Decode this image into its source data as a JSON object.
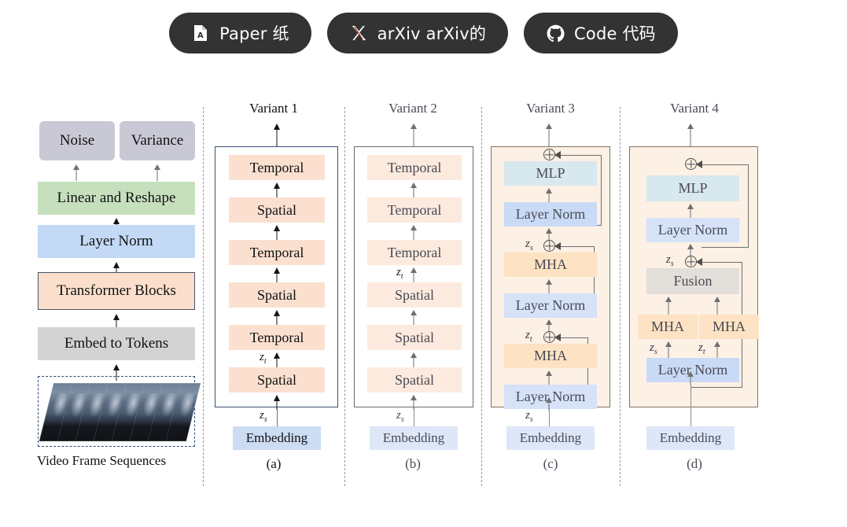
{
  "links": [
    {
      "id": "paper",
      "icon": "pdf-file-icon",
      "label": "Paper 纸"
    },
    {
      "id": "arxiv",
      "icon": "x-logo-icon",
      "label": "arXiv arXiv的"
    },
    {
      "id": "code",
      "icon": "github-icon",
      "label": "Code 代码"
    }
  ],
  "pipeline": {
    "outputs": [
      {
        "label": "Noise"
      },
      {
        "label": "Variance"
      }
    ],
    "blocks": [
      {
        "label": "Linear and Reshape"
      },
      {
        "label": "Layer Norm"
      },
      {
        "label": "Transformer Blocks"
      },
      {
        "label": "Embed to Tokens"
      }
    ],
    "input_caption": "Video Frame Sequences",
    "frame_count": 8
  },
  "variants": [
    {
      "title": "Variant 1",
      "caption": "(a)",
      "embedding": "Embedding",
      "blocks": [
        "Temporal",
        "Spatial",
        "Temporal",
        "Spatial",
        "Temporal",
        "Spatial"
      ],
      "z_labels": {
        "bottom": "z",
        "bottom_sub": "s",
        "mid": "z",
        "mid_sub": "t"
      }
    },
    {
      "title": "Variant 2",
      "caption": "(b)",
      "embedding": "Embedding",
      "blocks": [
        "Temporal",
        "Temporal",
        "Temporal",
        "Spatial",
        "Spatial",
        "Spatial"
      ],
      "z_labels": {
        "bottom": "z",
        "bottom_sub": "s",
        "mid": "z",
        "mid_sub": "t"
      }
    },
    {
      "title": "Variant 3",
      "caption": "(c)",
      "embedding": "Embedding",
      "blocks": [
        "MLP",
        "Layer Norm",
        "MHA",
        "Layer Norm",
        "MHA",
        "Layer Norm"
      ],
      "z_labels": {
        "bottom": "z",
        "bottom_sub": "s",
        "mid1": "z",
        "mid1_sub": "t",
        "mid2": "z",
        "mid2_sub": "s"
      }
    },
    {
      "title": "Variant 4",
      "caption": "(d)",
      "embedding": "Embedding",
      "blocks": [
        "MLP",
        "Layer Norm",
        "Fusion",
        "MHA",
        "MHA",
        "Layer Norm"
      ],
      "z_labels": {
        "top": "z",
        "top_sub": "s",
        "left": "z",
        "left_sub": "s",
        "right": "z",
        "right_sub": "t"
      }
    }
  ],
  "colors": {
    "button_bg": "#333333",
    "button_text": "#ffffff",
    "peach": "#fbe0d0",
    "layer_norm": "#c9daf6",
    "mlp": "#d7e8ee",
    "mha": "#fde3c3",
    "fusion": "#e3dfda",
    "embedding": "#ccdcf3",
    "panel_cd_bg": "#fdf0e4",
    "green": "#c6e0bd",
    "blue": "#c3d9f5",
    "gray": "#d3d3d3",
    "gray_out": "#c9c9d6"
  }
}
